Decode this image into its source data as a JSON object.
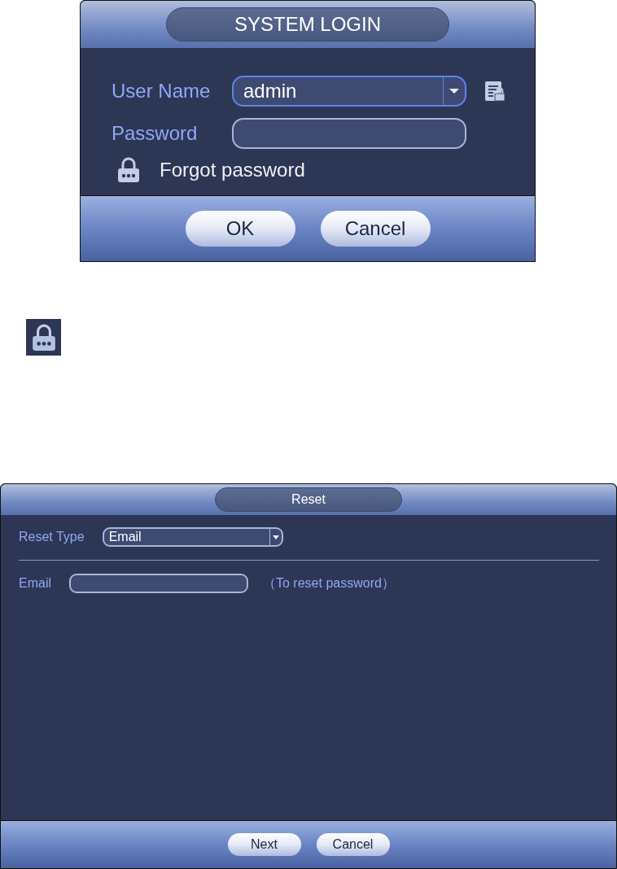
{
  "login_dialog": {
    "title": "SYSTEM LOGIN",
    "fields": [
      {
        "kind": "dropdown",
        "label": "User Name",
        "value": "admin",
        "account_icon": true
      },
      {
        "kind": "text",
        "label": "Password"
      }
    ],
    "forgot_link": "Forgot password",
    "buttons": [
      "OK",
      "Cancel"
    ]
  },
  "lock_icon_tile": {
    "kind": "lock"
  },
  "reset_dialog": {
    "title": "Reset",
    "fields": [
      {
        "kind": "dropdown",
        "label": "Reset Type",
        "value": "Email"
      },
      {
        "kind": "text",
        "label": "Email",
        "note": "（To reset password）"
      }
    ],
    "buttons": [
      "Next",
      "Cancel"
    ]
  }
}
